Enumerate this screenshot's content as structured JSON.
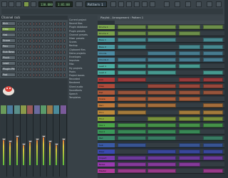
{
  "toolbar": {
    "pattern_label": "Pattern 1",
    "tempo": "130.000",
    "time": "1:01:00",
    "status": "SONG"
  },
  "channel_rack": {
    "title": "Channel rack",
    "channels": [
      {
        "label": "Kick",
        "selected": false
      },
      {
        "label": "Clap",
        "selected": true
      },
      {
        "label": "Hat",
        "selected": false
      },
      {
        "label": "Snare",
        "selected": false
      },
      {
        "label": "Perc",
        "selected": false
      },
      {
        "label": "Sub Bass",
        "selected": false
      },
      {
        "label": "Pluck",
        "selected": false
      },
      {
        "label": "Lead",
        "selected": false
      },
      {
        "label": "Plugin PH 1",
        "selected": false
      },
      {
        "label": "Pad",
        "selected": false
      }
    ]
  },
  "browser": {
    "items": [
      "Current project",
      "Recent files",
      "Plugin database",
      "Plugin presets",
      "Channel presets",
      "Mixer presets",
      "Scores",
      "Backup",
      "Clipboard files",
      "Demo projects",
      "Envelopes",
      "Impulses",
      "Misc",
      "My projects",
      "Packs",
      "Project bones",
      "Recorded",
      "Rendered",
      "Sliced audio",
      "Soundfonts",
      "Speech",
      "Templates"
    ]
  },
  "mixer": {
    "strip_colors": [
      "#6a9b5a",
      "#4d7d9e",
      "#5a8f8a",
      "#8a9a4a",
      "#9a5a5a",
      "#6a6a9e",
      "#5a9a6a",
      "#9a7a4a",
      "#4a8a9a",
      "#7a5a9a"
    ],
    "fader_levels": [
      0.55,
      0.5,
      0.6,
      0.45,
      0.5,
      0.55,
      0.6,
      0.5,
      0.45,
      0.55
    ]
  },
  "playlist": {
    "title": "Playlist - Arrangement › Pattern 1",
    "tracks": [
      {
        "label": "Drums 1",
        "color": "#7ba34c"
      },
      {
        "label": "Drums 2",
        "color": "#7ba34c"
      },
      {
        "label": "Bass 1",
        "color": "#4c9ba3"
      },
      {
        "label": "Bass 2",
        "color": "#4c9ba3"
      },
      {
        "label": "Chords",
        "color": "#4c8ba3"
      },
      {
        "label": "Chords 2",
        "color": "#4c8ba3"
      },
      {
        "label": "Lead 1",
        "color": "#4cb0a3"
      },
      {
        "label": "Lead 2",
        "color": "#4cb0a3"
      },
      {
        "label": "Kick",
        "color": "#b03a3a"
      },
      {
        "label": "Clap",
        "color": "#b04a3a"
      },
      {
        "label": "Hat",
        "color": "#b05a3a"
      },
      {
        "label": "Snare",
        "color": "#c0643a"
      },
      {
        "label": "Perc",
        "color": "#c07a3a"
      },
      {
        "label": "FX 1",
        "color": "#c08a3a"
      },
      {
        "label": "FX 2",
        "color": "#8aa63a"
      },
      {
        "label": "Vox 1",
        "color": "#4aa64a"
      },
      {
        "label": "Vox 2",
        "color": "#3a9a5a"
      },
      {
        "label": "Pad",
        "color": "#3a8a6a"
      },
      {
        "label": "Sub",
        "color": "#3a5aa6"
      },
      {
        "label": "Riser",
        "color": "#3a4ab0"
      },
      {
        "label": "Impact",
        "color": "#7a3ab0"
      },
      {
        "label": "Noise",
        "color": "#9a3ab0"
      },
      {
        "label": "Master",
        "color": "#b03a9a"
      }
    ]
  }
}
